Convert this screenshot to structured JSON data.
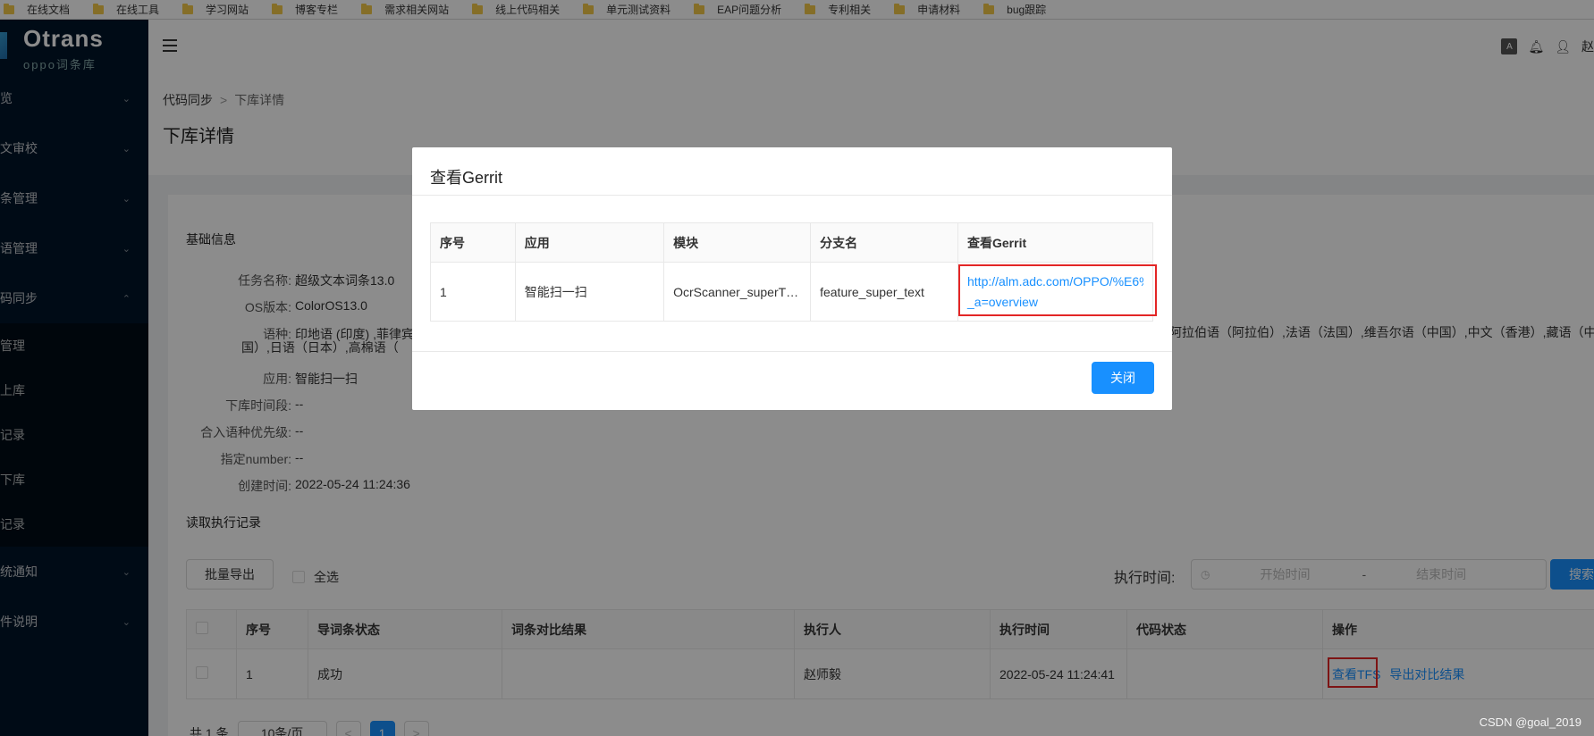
{
  "bookmarks": [
    "在线文档",
    "在线工具",
    "学习网站",
    "博客专栏",
    "需求相关网站",
    "线上代码相关",
    "单元测试资料",
    "EAP问题分析",
    "专利相关",
    "申请材料",
    "bug跟踪"
  ],
  "sidebar": {
    "logo_title": "Otrans",
    "logo_sub": "oppo词条库",
    "items_top": [
      "览",
      "文审校",
      "条管理",
      "语管理",
      "码同步"
    ],
    "sub_items": [
      "管理",
      "上库",
      "记录",
      "下库",
      "记录"
    ],
    "items_bottom": [
      "统通知",
      "件说明"
    ]
  },
  "header": {
    "lang_icon": "A",
    "user": "赵"
  },
  "breadcrumb": {
    "root": "代码同步",
    "sep": ">",
    "current": "下库详情"
  },
  "page_title": "下库详情",
  "basic": {
    "title": "基础信息",
    "task_name_label": "任务名称:",
    "task_name": "超级文本词条13.0",
    "os_label": "OS版本:",
    "os": "ColorOS13.0",
    "lang_label": "语种:",
    "lang_line1_left": "印地语 (印度) ,菲律宾",
    "lang_line1_right": "阿拉伯语（阿拉伯）,法语（法国）,维吾尔语（中国）,中文（香港）,藏语（中",
    "lang_line2": "国）,日语（日本）,高棉语（",
    "app_label": "应用:",
    "app": "智能扫一扫",
    "period_label": "下库时间段:",
    "period": "--",
    "priority_label": "合入语种优先级:",
    "priority": "--",
    "number_label": "指定number:",
    "number": "--",
    "created_label": "创建时间:",
    "created": "2022-05-24 11:24:36"
  },
  "records": {
    "title": "读取执行记录",
    "batch_export": "批量导出",
    "select_all": "全选",
    "time_label": "执行时间:",
    "start_placeholder": "开始时间",
    "dash": "-",
    "end_placeholder": "结束时间",
    "search": "搜索",
    "columns": [
      "序号",
      "导词条状态",
      "词条对比结果",
      "执行人",
      "执行时间",
      "代码状态",
      "操作"
    ],
    "row": {
      "index": "1",
      "status": "成功",
      "compare": "",
      "executor": "赵师毅",
      "time": "2022-05-24 11:24:41",
      "code_status": "",
      "action1": "查看TFS",
      "action2": "导出对比结果"
    },
    "total": "共 1 条",
    "page_size": "10条/页",
    "page": "1",
    "prev": "<",
    "next": ">"
  },
  "modal": {
    "title": "查看Gerrit",
    "columns": [
      "序号",
      "应用",
      "模块",
      "分支名",
      "查看Gerrit"
    ],
    "row": {
      "index": "1",
      "app": "智能扫一扫",
      "module": "OcrScanner_superT…",
      "branch": "feature_super_text",
      "link_line1": "http://alm.adc.com/OPPO/%E6%9",
      "link_line2": "_a=overview"
    },
    "close": "关闭"
  },
  "watermark": "CSDN @goal_2019",
  "colors": {
    "primary": "#1890ff",
    "sidebar": "#001529",
    "highlight": "#e32626"
  }
}
